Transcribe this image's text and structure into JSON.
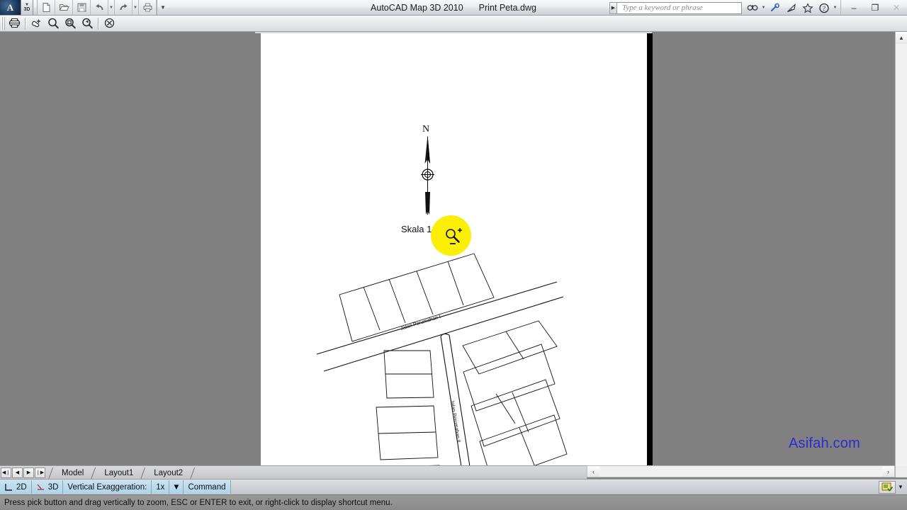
{
  "window": {
    "app_title": "AutoCAD Map 3D 2010",
    "document_title": "Print Peta.dwg",
    "app_logo_letter": "A",
    "mode_badge": "3D",
    "minimize_glyph": "–",
    "restore_glyph": "❐",
    "close_glyph": "✕"
  },
  "quick_access": {
    "items": [
      {
        "name": "new-document",
        "label": "New"
      },
      {
        "name": "open-document",
        "label": "Open"
      },
      {
        "name": "save-document",
        "label": "Save"
      },
      {
        "name": "undo",
        "label": "Undo"
      },
      {
        "name": "redo",
        "label": "Redo"
      },
      {
        "name": "plot",
        "label": "Plot"
      }
    ],
    "customize_label": "Customize Quick Access Toolbar"
  },
  "infocenter": {
    "placeholder": "Type a keyword or phrase",
    "expand_glyph": "▶",
    "buttons": [
      {
        "name": "search-icon",
        "label": "Search"
      },
      {
        "name": "communication-center-icon",
        "label": "Communication Center"
      },
      {
        "name": "favorites-star-icon",
        "label": "Favorites"
      },
      {
        "name": "help-icon",
        "label": "Help"
      }
    ]
  },
  "toolbar": {
    "items": [
      {
        "name": "plot-preview-plot-icon",
        "label": "Plot"
      },
      {
        "name": "pan-realtime-icon",
        "label": "Pan Realtime"
      },
      {
        "name": "zoom-realtime-icon",
        "label": "Zoom Realtime"
      },
      {
        "name": "zoom-window-icon",
        "label": "Zoom Window"
      },
      {
        "name": "zoom-previous-icon",
        "label": "Zoom Previous"
      },
      {
        "name": "close-preview-icon",
        "label": "Close Preview Window"
      }
    ]
  },
  "drawing": {
    "north_label": "N",
    "scale_label": "Skala 1 : 1000",
    "street_labels": [
      {
        "name": "street-label-jalan-perumahan-1",
        "text": "Jalan Perumahan I"
      },
      {
        "name": "street-label-jalan-perumahan-2",
        "text": "Jalan Perumahan II"
      }
    ],
    "watermark": "Asifah.com",
    "watermark_color": "#2b2bd4",
    "paper_color": "#ffffff",
    "background_color": "#808080",
    "cursor": {
      "name": "zoom-realtime-cursor",
      "highlight_color": "#fbee07",
      "plus_glyph": "+",
      "minus_glyph": "−"
    }
  },
  "layout_tabs": {
    "nav": [
      {
        "name": "first-tab-button",
        "glyph": "◀❘"
      },
      {
        "name": "previous-tab-button",
        "glyph": "◀"
      },
      {
        "name": "next-tab-button",
        "glyph": "▶"
      },
      {
        "name": "last-tab-button",
        "glyph": "❘▶"
      }
    ],
    "tabs": [
      {
        "name": "tab-model",
        "label": "Model",
        "active": false
      },
      {
        "name": "tab-layout1",
        "label": "Layout1",
        "active": false
      },
      {
        "name": "tab-layout2",
        "label": "Layout2",
        "active": false
      }
    ]
  },
  "scrollbars": {
    "vertical_up_glyph": "▲",
    "vertical_down_glyph": "▼",
    "horizontal_left_glyph": "‹",
    "horizontal_right_glyph": "›"
  },
  "statusbar": {
    "view_2d_label": "2D",
    "view_3d_label": "3D",
    "vertical_exaggeration_label": "Vertical Exaggeration:",
    "vertical_exaggeration_value": "1x",
    "dropdown_glyph": "▼",
    "command_label": "Command",
    "annotation_icon_name": "annotation-scale-icon",
    "annotation_caret_glyph": "▼"
  },
  "prompt": {
    "message": "Press pick button and drag vertically to zoom, ESC or ENTER to exit, or right-click to display shortcut menu."
  }
}
